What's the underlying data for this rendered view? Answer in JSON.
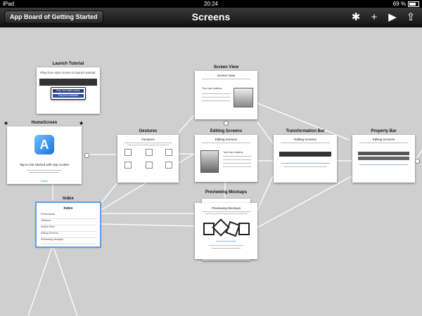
{
  "status": {
    "device": "iPad",
    "time": "20:24",
    "battery": "69 %"
  },
  "nav": {
    "back": "App Board of Getting Started",
    "title": "Screens",
    "tools": [
      "bug-icon",
      "plus-icon",
      "play-icon",
      "share-icon"
    ]
  },
  "cards": {
    "launch": {
      "title": "Launch Tutorial",
      "text": "Play from start screen to launch tutorial.",
      "btn1": "Play from start screen",
      "btn2": "Play from selected"
    },
    "home": {
      "title": "HomeScreen",
      "text": "Tap to Get Started with App Cooker",
      "link": "Index"
    },
    "gestures": {
      "title": "Gestures",
      "inner": "Gestures"
    },
    "screenview": {
      "title": "Screen View",
      "inner": "Screen View",
      "sub": "Tool bar buttons"
    },
    "editing": {
      "title": "Editing Screens",
      "inner": "Editing Screens",
      "sub": "Tool bar buttons"
    },
    "transformation": {
      "title": "Transformation Bar",
      "inner": "Editing Screens"
    },
    "property": {
      "title": "Property Bar",
      "inner": "Editing Screens"
    },
    "index": {
      "title": "Index",
      "inner": "Index",
      "rows": [
        "Preliminaries",
        "Gestures",
        "Screen View",
        "Editing Screens",
        "Previewing Mockups"
      ]
    },
    "previewing": {
      "title": "Previewing Mockups",
      "inner": "Previewing Mockups"
    }
  }
}
